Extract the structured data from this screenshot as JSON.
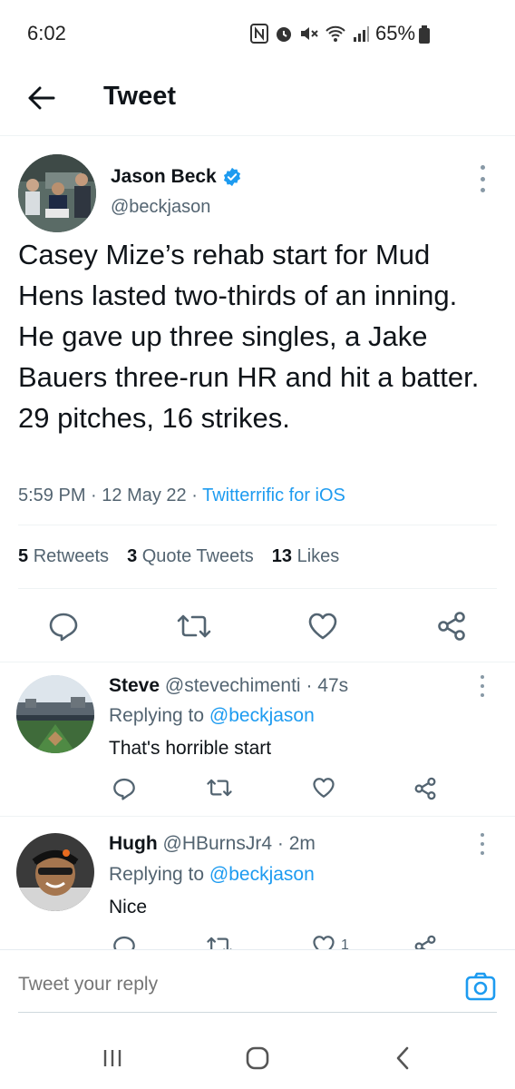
{
  "status_bar": {
    "time": "6:02",
    "battery": "65%"
  },
  "header": {
    "title": "Tweet"
  },
  "tweet": {
    "author_name": "Jason Beck",
    "author_handle": "@beckjason",
    "text": "Casey Mize’s rehab start for Mud Hens lasted two-thirds of an inning. He gave up three singles, a Jake Bauers three-run HR and hit a batter. 29 pitches, 16 strikes.",
    "time": "5:59 PM",
    "date": "12 May 22",
    "client": "Twitterrific for iOS",
    "retweets_count": "5",
    "retweets_label": "Retweets",
    "quotes_count": "3",
    "quotes_label": "Quote Tweets",
    "likes_count": "13",
    "likes_label": "Likes"
  },
  "replies": [
    {
      "name": "Steve",
      "handle": "@stevechimenti",
      "age": "47s",
      "replying_prefix": "Replying to",
      "replying_to": "@beckjason",
      "text": "That's horrible start",
      "like_count": ""
    },
    {
      "name": "Hugh",
      "handle": "@HBurnsJr4",
      "age": "2m",
      "replying_prefix": "Replying to",
      "replying_to": "@beckjason",
      "text": "Nice",
      "like_count": "1"
    }
  ],
  "composer": {
    "placeholder": "Tweet your reply"
  },
  "colors": {
    "accent": "#1d9bf0",
    "text": "#0f1419",
    "secondary": "#536471"
  },
  "icons": {
    "back": "arrow-left-icon",
    "verified": "verified-badge-icon",
    "more": "more-vertical-icon",
    "reply": "reply-icon",
    "retweet": "retweet-icon",
    "like": "heart-icon",
    "share": "share-icon",
    "camera": "camera-icon"
  }
}
